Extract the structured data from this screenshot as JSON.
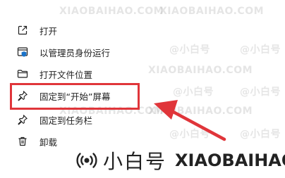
{
  "menu": {
    "items": [
      {
        "label": "打开",
        "icon": "open-external-icon"
      },
      {
        "label": "以管理员身份运行",
        "icon": "shield-admin-icon"
      },
      {
        "label": "打开文件位置",
        "icon": "folder-icon"
      },
      {
        "label": "固定到“开始”屏幕",
        "icon": "pin-icon"
      },
      {
        "label": "固定到任务栏",
        "icon": "pin-icon"
      },
      {
        "label": "卸载",
        "icon": "trash-icon"
      }
    ]
  },
  "watermark": {
    "domain_upper": "XIAOBAIHAO.COM",
    "cn_name": "@小白号"
  },
  "brand": {
    "name": "小白号",
    "domain": "XIAOBAIHAO.COM"
  },
  "colors": {
    "highlight": "#e0353a",
    "arrow": "#e0353a",
    "icon_blue": "#1a73c9"
  }
}
